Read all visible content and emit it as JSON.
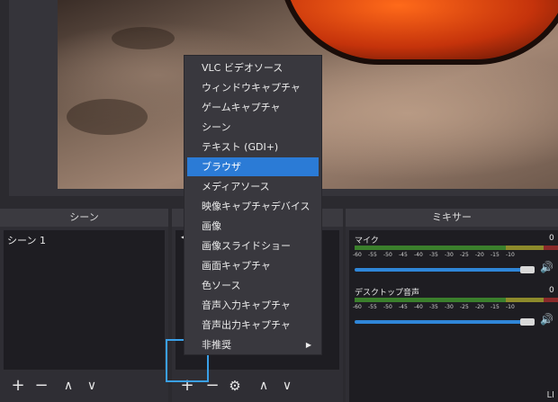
{
  "scenes": {
    "title": "シーン",
    "items": [
      "シーン 1"
    ],
    "toolbar": {
      "add": "+",
      "remove": "−",
      "up": "∧",
      "down": "∨"
    }
  },
  "sources": {
    "toolbar": {
      "add": "+",
      "remove": "−",
      "settings": "⚙",
      "up": "∧",
      "down": "∨"
    },
    "left_arrow": "◀"
  },
  "mixer": {
    "title": "ミキサー",
    "scale": [
      "-60",
      "-55",
      "-50",
      "-45",
      "-40",
      "-35",
      "-30",
      "-25",
      "-20",
      "-15",
      "-10"
    ],
    "tracks": [
      {
        "label": "マイク",
        "db": "0",
        "volume": 0.95
      },
      {
        "label": "デスクトップ音声",
        "db": "0",
        "volume": 0.95
      }
    ]
  },
  "context_menu": {
    "items": [
      {
        "label": "VLC ビデオソース",
        "selected": false
      },
      {
        "label": "ウィンドウキャプチャ",
        "selected": false
      },
      {
        "label": "ゲームキャプチャ",
        "selected": false
      },
      {
        "label": "シーン",
        "selected": false
      },
      {
        "label": "テキスト (GDI+)",
        "selected": false
      },
      {
        "label": "ブラウザ",
        "selected": true
      },
      {
        "label": "メディアソース",
        "selected": false
      },
      {
        "label": "映像キャプチャデバイス",
        "selected": false
      },
      {
        "label": "画像",
        "selected": false
      },
      {
        "label": "画像スライドショー",
        "selected": false
      },
      {
        "label": "画面キャプチャ",
        "selected": false
      },
      {
        "label": "色ソース",
        "selected": false
      },
      {
        "label": "音声入力キャプチャ",
        "selected": false
      },
      {
        "label": "音声出力キャプチャ",
        "selected": false
      },
      {
        "label": "非推奨",
        "selected": false,
        "submenu": true
      }
    ],
    "submenu_arrow": "▶"
  },
  "corner_text": "LI",
  "colors": {
    "accent": "#2b7bd6",
    "highlight_border": "#3aa0e8"
  }
}
